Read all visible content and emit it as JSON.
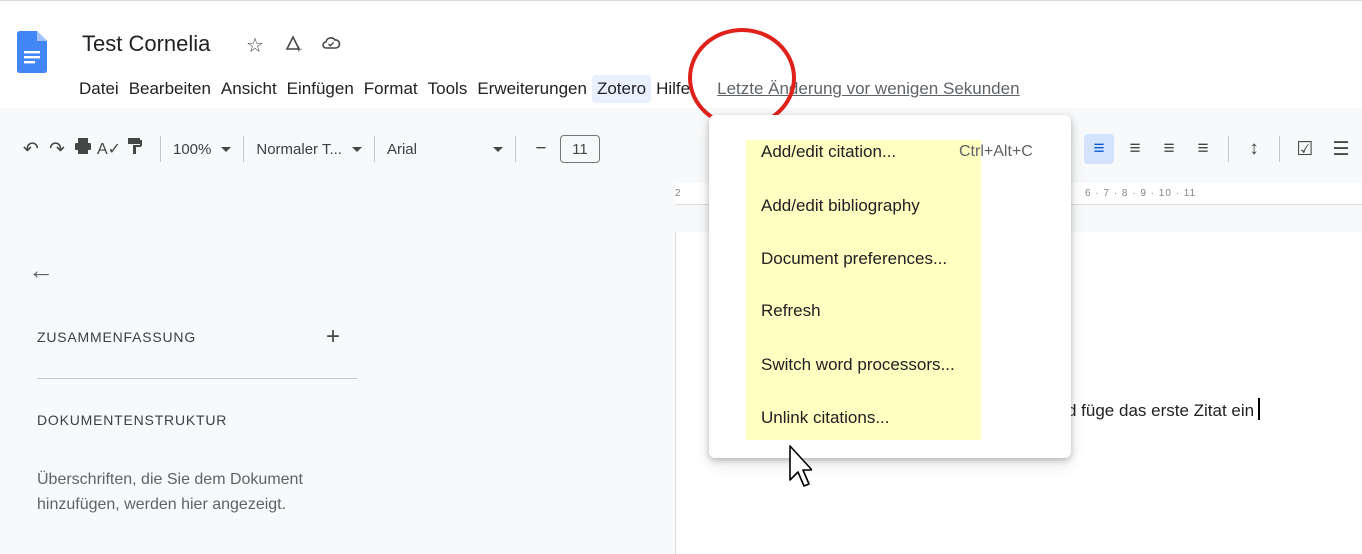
{
  "document": {
    "title": "Test Cornelia",
    "last_edit": "Letzte Änderung vor wenigen Sekunden"
  },
  "title_icons": [
    "star-icon",
    "move-to-folder-icon",
    "cloud-saved-icon"
  ],
  "menu": {
    "items": [
      "Datei",
      "Bearbeiten",
      "Ansicht",
      "Einfügen",
      "Format",
      "Tools",
      "Erweiterungen",
      "Zotero",
      "Hilfe"
    ],
    "active": "Zotero"
  },
  "toolbar": {
    "zoom": "100%",
    "style": "Normaler T...",
    "font": "Arial",
    "font_size": "11",
    "minus": "−"
  },
  "ruler": {
    "left_mark": "2",
    "right_marks": "6 · 7 · 8 · 9 · 10 · 11"
  },
  "sidebar": {
    "summary_label": "ZUSAMMENFASSUNG",
    "add_symbol": "+",
    "structure_label": "DOKUMENTENSTRUKTUR",
    "hint": "Überschriften, die Sie dem Dokument hinzufügen, werden hier angezeigt."
  },
  "page": {
    "visible_text": "d füge das erste Zitat ein"
  },
  "zotero_menu": {
    "items": [
      {
        "label": "Add/edit citation...",
        "shortcut": "Ctrl+Alt+C"
      },
      {
        "label": "Add/edit bibliography"
      },
      {
        "label": "Document preferences..."
      },
      {
        "label": "Refresh"
      },
      {
        "label": "Switch word processors..."
      },
      {
        "label": "Unlink citations..."
      }
    ],
    "highlight_color": "#feffc0"
  },
  "colors": {
    "annotation_circle": "#e0201a",
    "docs_blue": "#4285f4",
    "active_menu_bg": "#e8f0fe"
  }
}
